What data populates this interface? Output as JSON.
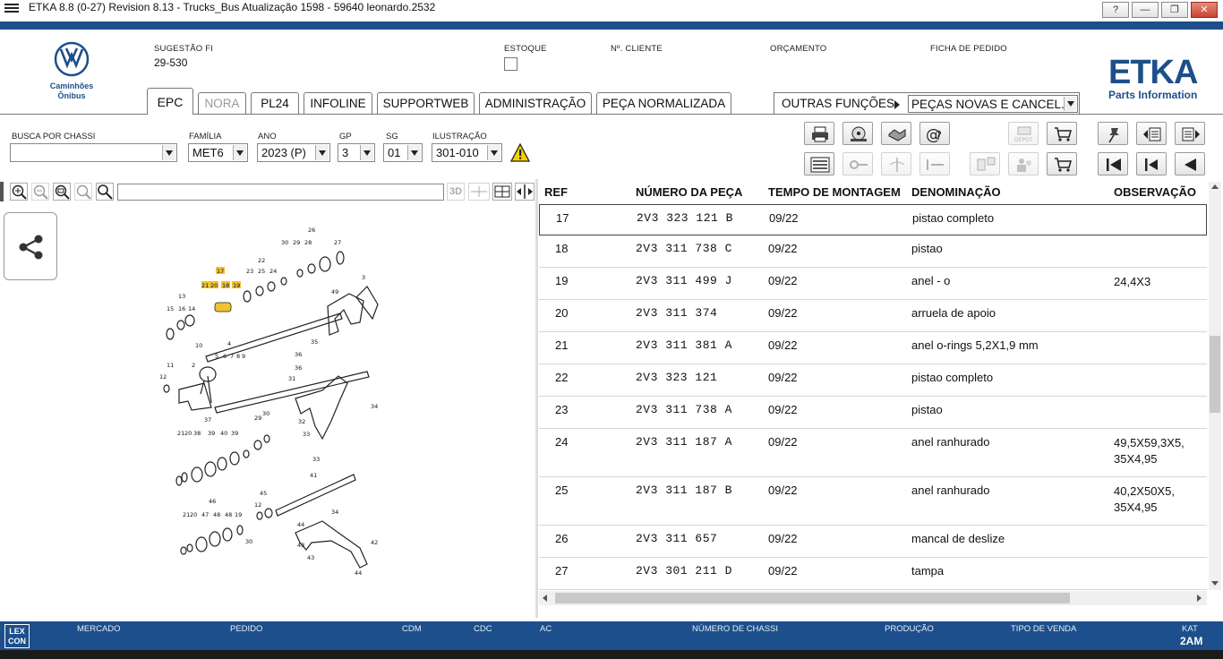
{
  "window": {
    "title": "ETKA 8.8 (0-27) Revision 8.13 - Trucks_Bus Atualização 1598 - 59640 leonardo.2532",
    "buttons": [
      "?",
      "—",
      "❐",
      "✕"
    ]
  },
  "brand": {
    "vw_caption_1": "Caminhões",
    "vw_caption_2": "Ônibus",
    "etka": "ETKA",
    "etka_sub": "Parts Information"
  },
  "header": {
    "sugestao_label": "SUGESTÃO FI",
    "sugestao_value": "29-530",
    "estoque_label": "ESTOQUE",
    "cliente_label": "Nº. CLIENTE",
    "orcamento_label": "ORÇAMENTO",
    "ficha_label": "FICHA DE PEDIDO"
  },
  "tabs": [
    {
      "label": "EPC",
      "state": "active"
    },
    {
      "label": "NORA",
      "state": "disabled"
    },
    {
      "label": "PL24",
      "state": "normal"
    },
    {
      "label": "INFOLINE",
      "state": "normal"
    },
    {
      "label": "SUPPORTWEB",
      "state": "normal"
    },
    {
      "label": "ADMINISTRAÇÃO",
      "state": "normal"
    },
    {
      "label": "PEÇA NORMALIZADA",
      "state": "normal"
    }
  ],
  "outras": {
    "label": "OUTRAS FUNÇÕES",
    "selected": "PEÇAS NOVAS E CANCEL."
  },
  "filters": {
    "chassi_label": "BUSCA POR CHASSI",
    "chassi_value": "",
    "familia_label": "FAMÍLIA",
    "familia_value": "MET6",
    "ano_label": "ANO",
    "ano_value": "2023 (P)",
    "gp_label": "GP",
    "gp_value": "3",
    "sg_label": "SG",
    "sg_value": "01",
    "ilustracao_label": "ILUSTRAÇÃO",
    "ilustracao_value": "301-010"
  },
  "left_toolbar": {
    "label_3d": "3D"
  },
  "table": {
    "headers": [
      "REF",
      "NÚMERO DA PEÇA",
      "TEMPO DE MONTAGEM",
      "DENOMINAÇÃO",
      "OBSERVAÇÃO"
    ],
    "rows": [
      {
        "ref": "17",
        "part": "2V3 323 121 B",
        "tempo": "09/22",
        "denom": "pistao completo",
        "obs": ""
      },
      {
        "ref": "18",
        "part": "2V3 311 738 C",
        "tempo": "09/22",
        "denom": "pistao",
        "obs": ""
      },
      {
        "ref": "19",
        "part": "2V3 311 499 J",
        "tempo": "09/22",
        "denom": "anel - o",
        "obs": "24,4X3"
      },
      {
        "ref": "20",
        "part": "2V3 311 374",
        "tempo": "09/22",
        "denom": "arruela de apoio",
        "obs": ""
      },
      {
        "ref": "21",
        "part": "2V3 311 381 A",
        "tempo": "09/22",
        "denom": "anel o-rings 5,2X1,9 mm",
        "obs": ""
      },
      {
        "ref": "22",
        "part": "2V3 323 121",
        "tempo": "09/22",
        "denom": "pistao completo",
        "obs": ""
      },
      {
        "ref": "23",
        "part": "2V3 311 738 A",
        "tempo": "09/22",
        "denom": "pistao",
        "obs": ""
      },
      {
        "ref": "24",
        "part": "2V3 311 187 A",
        "tempo": "09/22",
        "denom": "anel ranhurado",
        "obs": "49,5X59,3X5,",
        "obs2": "35X4,95"
      },
      {
        "ref": "25",
        "part": "2V3 311 187 B",
        "tempo": "09/22",
        "denom": "anel ranhurado",
        "obs": "40,2X50X5,",
        "obs2": "35X4,95"
      },
      {
        "ref": "26",
        "part": "2V3 311 657",
        "tempo": "09/22",
        "denom": "mancal de deslize",
        "obs": ""
      },
      {
        "ref": "27",
        "part": "2V3 301 211 D",
        "tempo": "09/22",
        "denom": "tampa",
        "obs": ""
      }
    ]
  },
  "statusbar": {
    "lexcon": "LEX CON",
    "labels": [
      "MERCADO",
      "PEDIDO",
      "CDM",
      "CDC",
      "AC",
      "NÚMERO DE CHASSI",
      "PRODUÇÃO",
      "TIPO DE VENDA",
      "KAT"
    ],
    "kat_value": "2AM"
  },
  "diagram_labels": [
    "26",
    "30",
    "29",
    "28",
    "27",
    "22",
    "23",
    "25",
    "24",
    "17",
    "21",
    "20",
    "18",
    "19",
    "13",
    "15",
    "16",
    "14",
    "3",
    "49",
    "10",
    "4",
    "5",
    "6",
    "7",
    "8",
    "9",
    "35",
    "36",
    "11",
    "2",
    "12",
    "31",
    "34",
    "32",
    "33",
    "37",
    "21",
    "20",
    "38",
    "39",
    "40",
    "39",
    "30",
    "29",
    "41",
    "46",
    "45",
    "12",
    "44",
    "34",
    "42",
    "43",
    "44",
    "47",
    "48",
    "19",
    "30"
  ],
  "colors": {
    "brand_blue": "#1c4f8b",
    "highlight": "#f2c230"
  }
}
